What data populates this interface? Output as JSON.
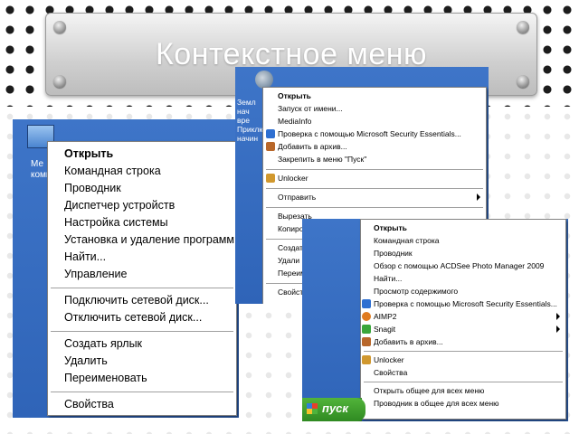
{
  "slide": {
    "title": "Контекстное меню"
  },
  "panel_left": {
    "desktop_labels": [
      "Ме",
      "компь"
    ],
    "menu_items": [
      {
        "label": "Открыть",
        "bold": true
      },
      {
        "label": "Командная строка"
      },
      {
        "label": "Проводник"
      },
      {
        "label": "Диспетчер устройств"
      },
      {
        "label": "Настройка системы"
      },
      {
        "label": "Установка и удаление программ"
      },
      {
        "label": "Найти..."
      },
      {
        "label": "Управление"
      },
      {
        "sep": true
      },
      {
        "label": "Подключить сетевой диск..."
      },
      {
        "label": "Отключить сетевой диск..."
      },
      {
        "sep": true
      },
      {
        "label": "Создать ярлык"
      },
      {
        "label": "Удалить"
      },
      {
        "label": "Переименовать"
      },
      {
        "sep": true
      },
      {
        "label": "Свойства"
      }
    ]
  },
  "panel_middle": {
    "desktop_labels": [
      "Земл",
      "нач",
      "вре",
      "Приклю",
      "начин"
    ],
    "menu_items": [
      {
        "label": "Открыть",
        "bold": true
      },
      {
        "label": "Запуск от имени..."
      },
      {
        "label": "MediaInfo"
      },
      {
        "label": "Проверка с помощью Microsoft Security Essentials...",
        "icon": "shield-icon"
      },
      {
        "label": "Добавить в архив...",
        "icon": "archive-icon"
      },
      {
        "label": "Закрепить в меню \"Пуск\""
      },
      {
        "sep": true
      },
      {
        "label": "Unlocker",
        "icon": "unlocker-icon"
      },
      {
        "sep": true
      },
      {
        "label": "Отправить",
        "submenu": true
      },
      {
        "sep": true
      },
      {
        "label": "Вырезать"
      },
      {
        "label": "Копиро"
      },
      {
        "sep": true
      },
      {
        "label": "Создат"
      },
      {
        "label": "Удали"
      },
      {
        "label": "Переим"
      },
      {
        "sep": true
      },
      {
        "label": "Свойст"
      }
    ]
  },
  "panel_right": {
    "taskbar": {
      "start_label": "пуск"
    },
    "menu_items": [
      {
        "label": "Открыть",
        "bold": true
      },
      {
        "label": "Командная строка"
      },
      {
        "label": "Проводник"
      },
      {
        "label": "Обзор с помощью ACDSee Photo Manager 2009"
      },
      {
        "label": "Найти..."
      },
      {
        "label": "Просмотр содержимого"
      },
      {
        "label": "Проверка с помощью Microsoft Security Essentials...",
        "icon": "shield-icon"
      },
      {
        "label": "AIMP2",
        "icon": "aimp-icon",
        "submenu": true
      },
      {
        "label": "Snagit",
        "icon": "snagit-icon",
        "submenu": true
      },
      {
        "label": "Добавить в архив...",
        "icon": "archive-icon"
      },
      {
        "sep": true
      },
      {
        "label": "Unlocker",
        "icon": "unlocker-icon"
      },
      {
        "label": "Свойства"
      },
      {
        "sep": true
      },
      {
        "label": "Открыть общее для всех меню"
      },
      {
        "label": "Проводник в общее для всех меню"
      }
    ]
  },
  "colors": {
    "desktop_blue": "#3a6ea5",
    "taskbar_green": "#3c8c35",
    "title_text": "#ffffff"
  }
}
